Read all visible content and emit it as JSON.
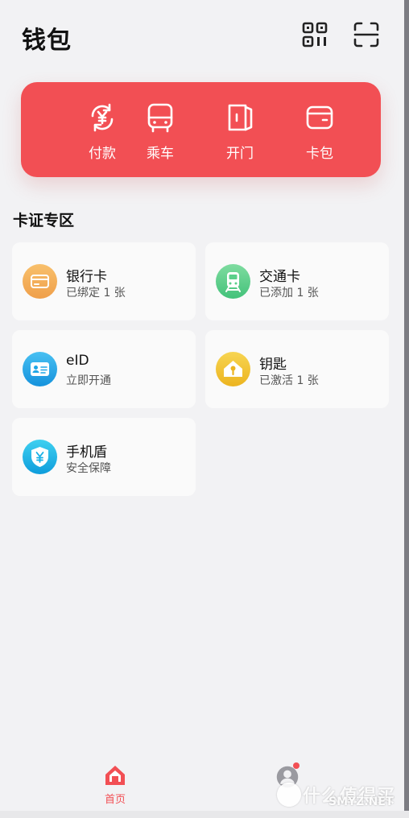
{
  "header": {
    "title": "钱包",
    "qr_icon": "qr-code-icon",
    "scan_icon": "scan-icon"
  },
  "colors": {
    "accent": "#f24f54",
    "bank": "#f4b060",
    "transit": "#5bcf8a",
    "eid": "#1fa6e6",
    "key": "#f2c230",
    "shield": "#16b0e6"
  },
  "quick_actions": [
    {
      "label": "付款",
      "icon": "yuan-refresh-icon"
    },
    {
      "label": "乘车",
      "icon": "bus-icon"
    },
    {
      "label": "开门",
      "icon": "door-icon"
    },
    {
      "label": "卡包",
      "icon": "wallet-icon"
    }
  ],
  "section": {
    "title": "卡证专区"
  },
  "cards": [
    {
      "name": "银行卡",
      "sub": "已绑定 1 张",
      "icon": "bank-card-icon"
    },
    {
      "name": "交通卡",
      "sub": "已添加 1 张",
      "icon": "train-icon"
    },
    {
      "name": "eID",
      "sub": "立即开通",
      "icon": "id-card-icon"
    },
    {
      "name": "钥匙",
      "sub": "已激活 1 张",
      "icon": "home-key-icon"
    },
    {
      "name": "手机盾",
      "sub": "安全保障",
      "icon": "shield-yuan-icon"
    }
  ],
  "tabbar": {
    "home_label": "首页",
    "home_icon": "home-icon",
    "me_icon": "avatar-icon"
  },
  "watermark": {
    "text": "什么值得买",
    "site": "SMYZ.NET"
  }
}
